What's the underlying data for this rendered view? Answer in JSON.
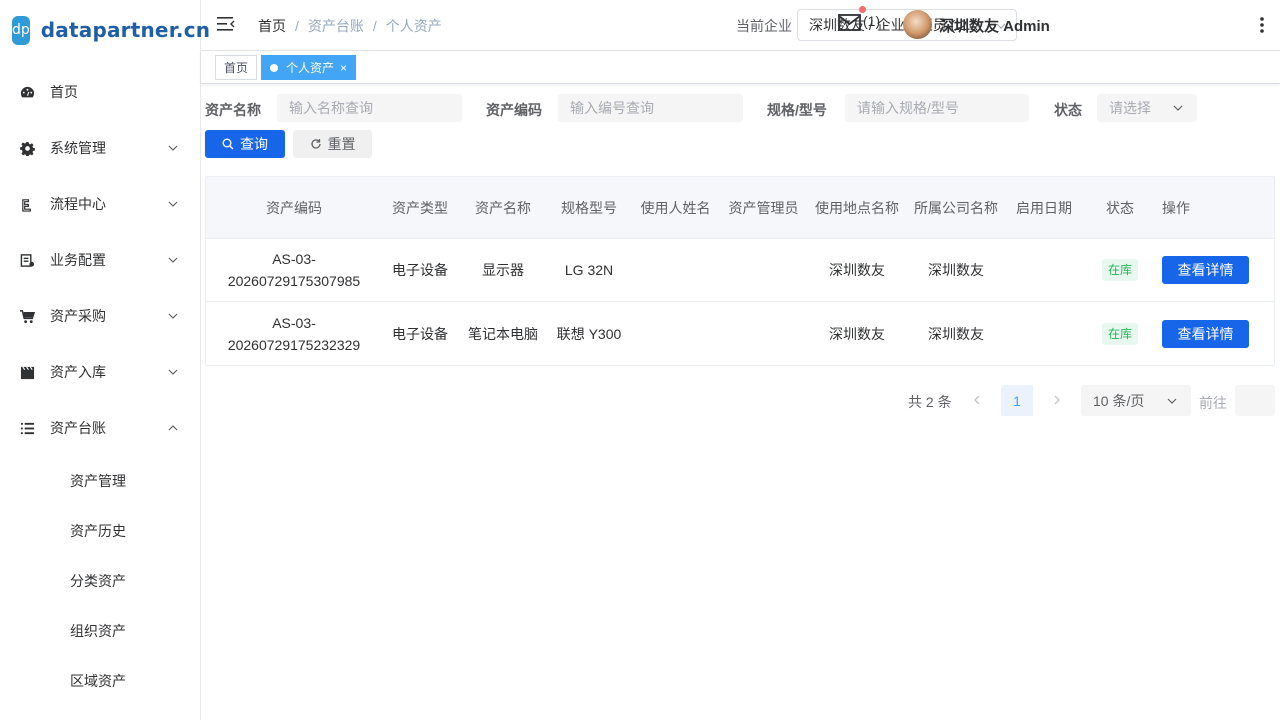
{
  "brand": {
    "badge": "dp",
    "name": "datapartner.cn"
  },
  "sidebar": {
    "items": [
      {
        "label": "首页",
        "icon": "dashboard-icon",
        "arrow": ""
      },
      {
        "label": "系统管理",
        "icon": "gear-icon",
        "arrow": "down"
      },
      {
        "label": "流程中心",
        "icon": "flow-icon",
        "arrow": "down"
      },
      {
        "label": "业务配置",
        "icon": "config-icon",
        "arrow": "down"
      },
      {
        "label": "资产采购",
        "icon": "cart-icon",
        "arrow": "down"
      },
      {
        "label": "资产入库",
        "icon": "clapper-icon",
        "arrow": "down"
      },
      {
        "label": "资产台账",
        "icon": "list-icon",
        "arrow": "up"
      }
    ],
    "sub_items": [
      "资产管理",
      "资产历史",
      "分类资产",
      "组织资产",
      "区域资产"
    ]
  },
  "header": {
    "breadcrumb": [
      "首页",
      "资产台账",
      "个人资产"
    ],
    "company_label": "当前企业",
    "company_value": "深圳数友 / 企业管理员 (t2...",
    "mail_count": "(1)",
    "user_name": "深圳数友 Admin"
  },
  "tags": [
    {
      "label": "首页",
      "active": false
    },
    {
      "label": "个人资产",
      "active": true,
      "close": "×"
    }
  ],
  "search": {
    "name_label": "资产名称",
    "name_placeholder": "输入名称查询",
    "code_label": "资产编码",
    "code_placeholder": "输入编号查询",
    "spec_label": "规格/型号",
    "spec_placeholder": "请输入规格/型号",
    "status_label": "状态",
    "status_placeholder": "请选择",
    "query_label": "查询",
    "reset_label": "重置"
  },
  "table": {
    "headers": [
      "资产编码",
      "资产类型",
      "资产名称",
      "规格型号",
      "使用人姓名",
      "资产管理员",
      "使用地点名称",
      "所属公司名称",
      "启用日期",
      "状态",
      "操作"
    ],
    "rows": [
      {
        "code": "AS-03-20260729175307985",
        "type": "电子设备",
        "name": "显示器",
        "spec": "LG 32N",
        "user": "",
        "admin": "",
        "location": "深圳数友",
        "company": "深圳数友",
        "date": "",
        "status": "在库",
        "action": "查看详情"
      },
      {
        "code": "AS-03-20260729175232329",
        "type": "电子设备",
        "name": "笔记本电脑",
        "spec": "联想 Y300",
        "user": "",
        "admin": "",
        "location": "深圳数友",
        "company": "深圳数友",
        "date": "",
        "status": "在库",
        "action": "查看详情"
      }
    ]
  },
  "pagination": {
    "total": "共 2 条",
    "current_page": "1",
    "page_size": "10 条/页",
    "goto_label": "前往"
  },
  "colors": {
    "primary": "#1765e8",
    "tag_active": "#42a5f5",
    "status_green": "#26b35a",
    "brand_blue": "#1f5fa8"
  }
}
